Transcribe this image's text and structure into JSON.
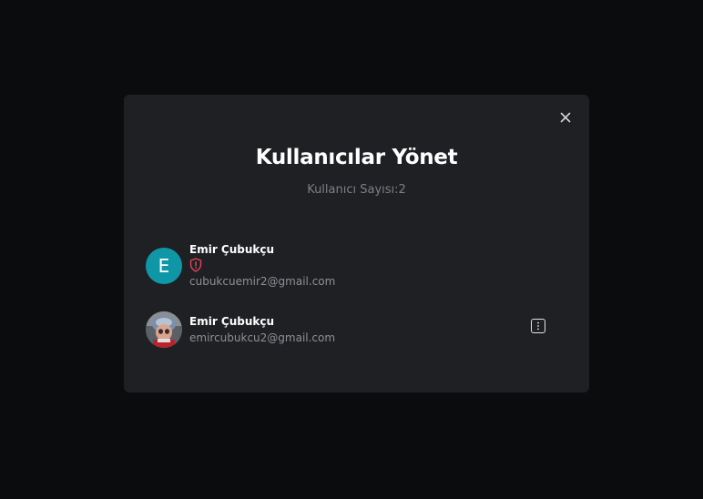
{
  "modal": {
    "title": "Kullanıcılar Yönet",
    "subtitle": "Kullanıcı Sayısı:2",
    "close_icon": "close-icon"
  },
  "users": [
    {
      "avatar_letter": "E",
      "avatar_color": "#1097a7",
      "name": "Emir Çubukçu",
      "badge_icon": "shield-alert-icon",
      "badge_color": "#e0455a",
      "email": "cubukcuemir2@gmail.com"
    },
    {
      "avatar_icon": "profile-photo",
      "name": "Emir Çubukçu",
      "email": "emircubukcu2@gmail.com",
      "action_icon": "more-vertical-icon"
    }
  ],
  "colors": {
    "background": "#0b0c0d",
    "modal": "#1f2023",
    "accent": "#1097a7",
    "danger": "#e0455a"
  }
}
